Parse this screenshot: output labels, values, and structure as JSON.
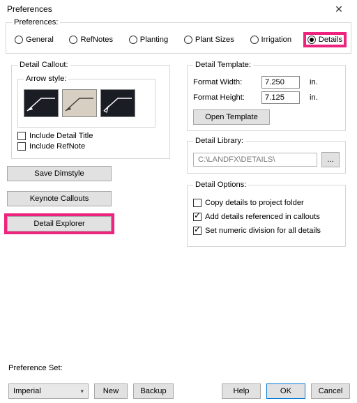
{
  "window": {
    "title": "Preferences"
  },
  "prefs": {
    "legend": "Preferences:",
    "tabs": [
      {
        "label": "General"
      },
      {
        "label": "RefNotes"
      },
      {
        "label": "Planting"
      },
      {
        "label": "Plant Sizes"
      },
      {
        "label": "Irrigation"
      },
      {
        "label": "Details",
        "selected": true,
        "highlight": true
      }
    ]
  },
  "detail_callout": {
    "legend": "Detail Callout:",
    "arrow_legend": "Arrow style:",
    "include_title": "Include Detail Title",
    "include_refnote": "Include RefNote"
  },
  "left_buttons": {
    "save_dimstyle": "Save Dimstyle",
    "keynote_callouts": "Keynote Callouts",
    "detail_explorer": "Detail Explorer"
  },
  "detail_template": {
    "legend": "Detail Template:",
    "width_label": "Format Width:",
    "width_value": "7.250",
    "height_label": "Format Height:",
    "height_value": "7.125",
    "unit": "in.",
    "open_template": "Open Template"
  },
  "detail_library": {
    "legend": "Detail Library:",
    "path": "C:\\LANDFX\\DETAILS\\",
    "browse": "..."
  },
  "detail_options": {
    "legend": "Detail Options:",
    "copy": "Copy details to project folder",
    "add_ref": "Add details referenced in callouts",
    "numeric": "Set numeric division for all details"
  },
  "pref_set": {
    "label": "Preference Set:",
    "value": "Imperial",
    "new_btn": "New",
    "backup_btn": "Backup"
  },
  "footer": {
    "help": "Help",
    "ok": "OK",
    "cancel": "Cancel"
  }
}
